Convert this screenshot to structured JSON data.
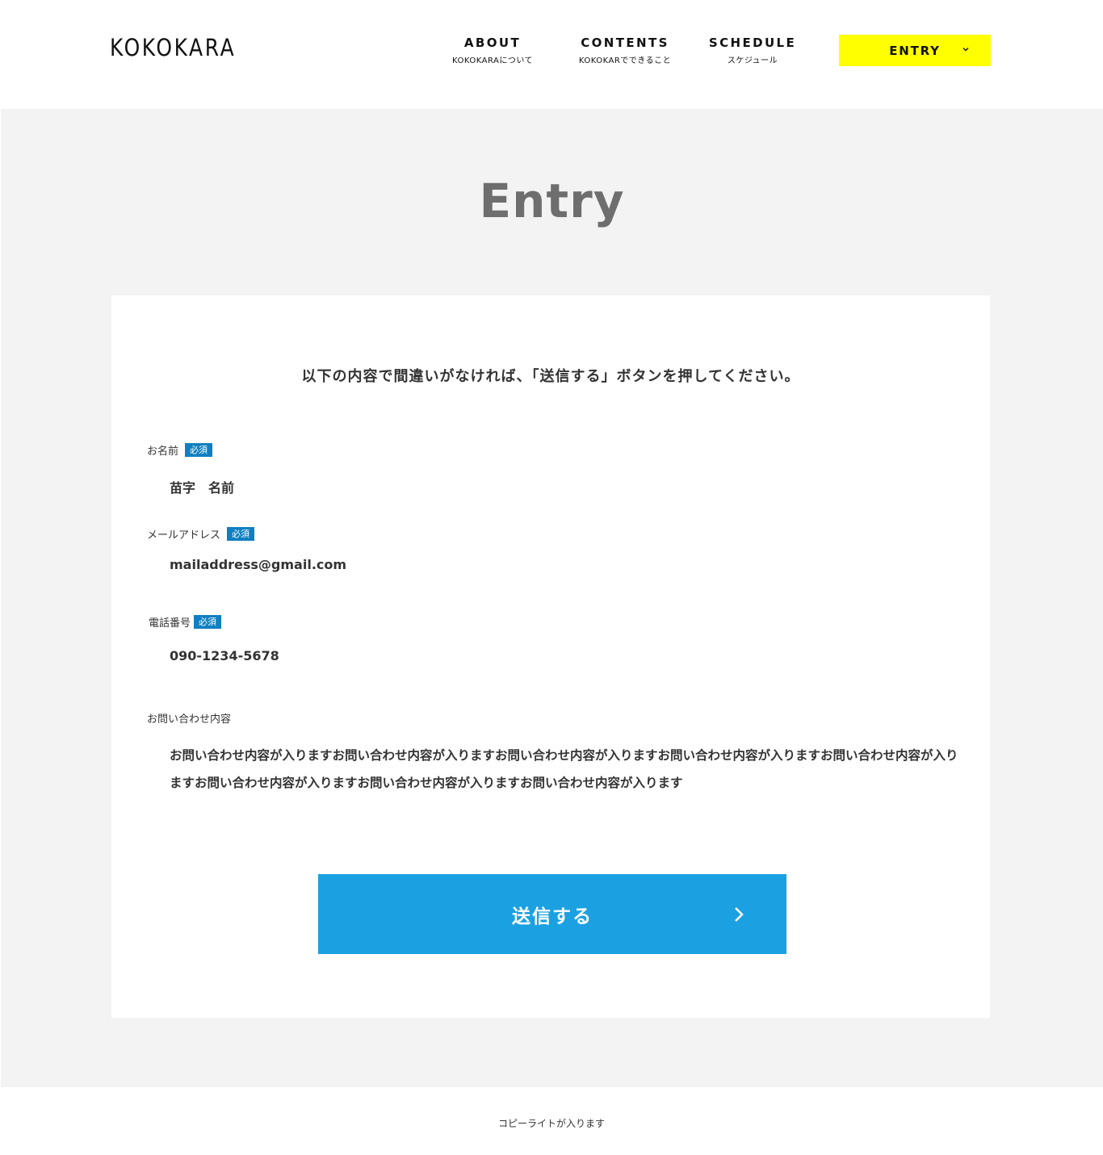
{
  "header": {
    "logo": "KOKOKARA",
    "nav": [
      {
        "label": "ABOUT",
        "sub": "KOKOKARAについて"
      },
      {
        "label": "CONTENTS",
        "sub": "KOKOKARでできること"
      },
      {
        "label": "SCHEDULE",
        "sub": "スケジュール"
      }
    ],
    "entry_label": "ENTRY"
  },
  "main": {
    "title": "Entry",
    "lead": "以下の内容で間違いがなければ、「送信する」ボタンを押してください。",
    "fields": {
      "name": {
        "label": "お名前",
        "badge": "必須",
        "value": "苗字　名前"
      },
      "email": {
        "label": "メールアドレス",
        "badge": "必須",
        "value": "mailaddress@gmail.com"
      },
      "phone": {
        "label": "電話番号",
        "badge": "必須",
        "value": "090-1234-5678"
      },
      "message": {
        "label": "お問い合わせ内容",
        "value": "お問い合わせ内容が入りますお問い合わせ内容が入りますお問い合わせ内容が入りますお問い合わせ内容が入りますお問い合わせ内容が入りますお問い合わせ内容が入りますお問い合わせ内容が入りますお問い合わせ内容が入ります"
      }
    },
    "submit_label": "送信する"
  },
  "footer": {
    "copyright": "コピーライトが入ります"
  },
  "colors": {
    "entry_button": "#ffff00",
    "submit_button": "#1ba1e2",
    "badge": "#0f7fc1",
    "background": "#f3f3f3"
  }
}
